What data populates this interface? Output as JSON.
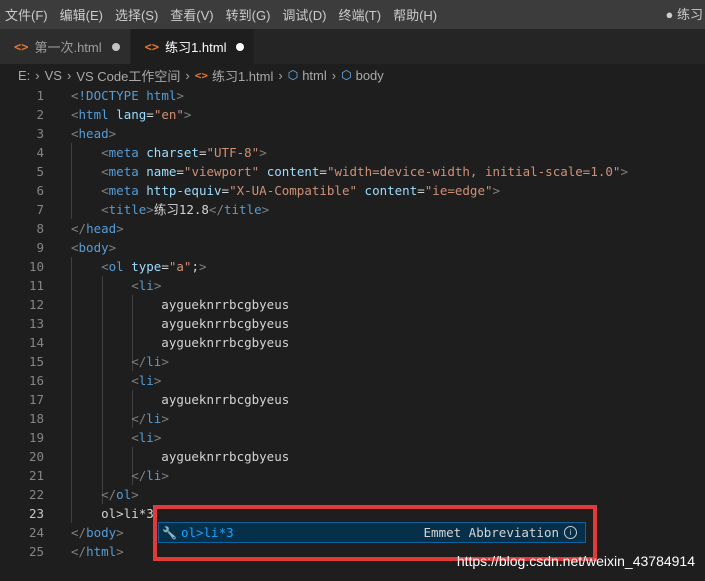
{
  "menu": {
    "items": [
      "文件(F)",
      "编辑(E)",
      "选择(S)",
      "查看(V)",
      "转到(G)",
      "调试(D)",
      "终端(T)",
      "帮助(H)"
    ],
    "window_title": "● 练习"
  },
  "tabs": [
    {
      "label": "第一次.html",
      "active": false,
      "modified": true
    },
    {
      "label": "练习1.html",
      "active": true,
      "modified": true
    }
  ],
  "breadcrumb": [
    "E:",
    "VS",
    "VS Code工作空间",
    "练习1.html",
    "html",
    "body"
  ],
  "editor": {
    "current_line": 23,
    "lines": [
      {
        "n": "1",
        "text": "<!DOCTYPE html>"
      },
      {
        "n": "2",
        "text": "<html lang=\"en\">"
      },
      {
        "n": "3",
        "text": "<head>"
      },
      {
        "n": "4",
        "text": "    <meta charset=\"UTF-8\">"
      },
      {
        "n": "5",
        "text": "    <meta name=\"viewport\" content=\"width=device-width, initial-scale=1.0\">"
      },
      {
        "n": "6",
        "text": "    <meta http-equiv=\"X-UA-Compatible\" content=\"ie=edge\">"
      },
      {
        "n": "7",
        "text": "    <title>练习12.8</title>"
      },
      {
        "n": "8",
        "text": "</head>"
      },
      {
        "n": "9",
        "text": "<body>"
      },
      {
        "n": "10",
        "text": "    <ol type=\"a\";>"
      },
      {
        "n": "11",
        "text": "        <li>"
      },
      {
        "n": "12",
        "text": "            aygueknrrbcgbyeus"
      },
      {
        "n": "13",
        "text": "            aygueknrrbcgbyeus"
      },
      {
        "n": "14",
        "text": "            aygueknrrbcgbyeus"
      },
      {
        "n": "15",
        "text": "        </li>"
      },
      {
        "n": "16",
        "text": "        <li>"
      },
      {
        "n": "17",
        "text": "            aygueknrrbcgbyeus"
      },
      {
        "n": "18",
        "text": "        </li>"
      },
      {
        "n": "19",
        "text": "        <li>"
      },
      {
        "n": "20",
        "text": "            aygueknrrbcgbyeus"
      },
      {
        "n": "21",
        "text": "        </li>"
      },
      {
        "n": "22",
        "text": "    </ol>"
      },
      {
        "n": "23",
        "text": "    ol>li*3"
      },
      {
        "n": "24",
        "text": "</body>"
      },
      {
        "n": "25",
        "text": "</html>"
      }
    ]
  },
  "suggest": {
    "match": "ol>li*3",
    "rest": "",
    "detail": "Emmet Abbreviation"
  },
  "watermark": "https://blog.csdn.net/weixin_43784914",
  "colors": {
    "tag": "#569cd6",
    "attribute": "#9cdcfe",
    "string": "#ce9178",
    "highlight_box": "#e03a3a"
  }
}
